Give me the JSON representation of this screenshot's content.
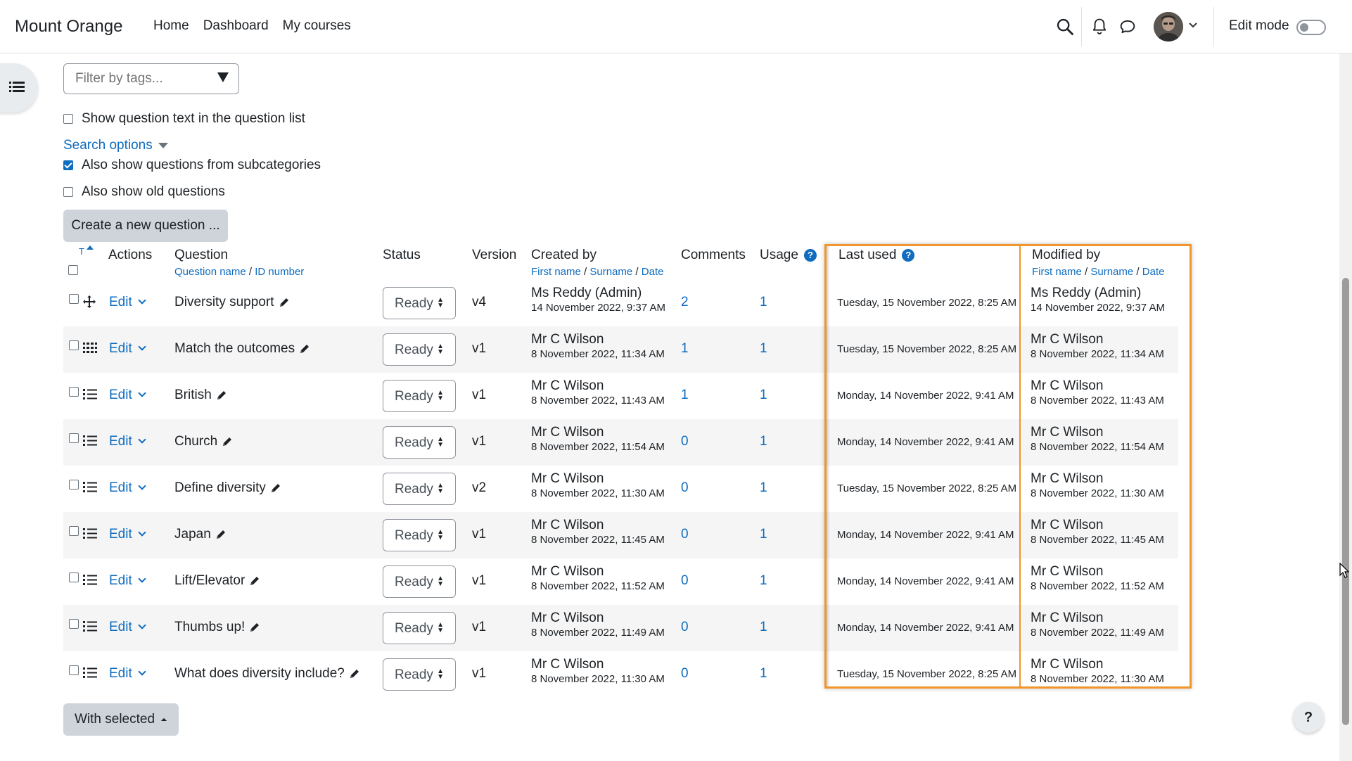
{
  "site": {
    "name": "Mount Orange"
  },
  "nav": {
    "home": "Home",
    "dashboard": "Dashboard",
    "my_courses": "My courses",
    "edit_mode": "Edit mode"
  },
  "filters": {
    "tags_placeholder": "Filter by tags...",
    "show_question_text": "Show question text in the question list",
    "search_options": "Search options",
    "subcategories": "Also show questions from subcategories",
    "old_questions": "Also show old questions",
    "create_button": "Create a new question ..."
  },
  "table": {
    "headers": {
      "type": "T",
      "actions": "Actions",
      "question": "Question",
      "question_name": "Question name",
      "id_number": "ID number",
      "status": "Status",
      "version": "Version",
      "created_by": "Created by",
      "first_name": "First name",
      "surname": "Surname",
      "date": "Date",
      "comments": "Comments",
      "usage": "Usage",
      "last_used": "Last used",
      "modified_by": "Modified by",
      "sep": "/"
    },
    "edit_label": "Edit",
    "rows": [
      {
        "icon": "move-icon",
        "question": "Diversity support",
        "status": "Ready",
        "version": "v4",
        "created_by": "Ms Reddy (Admin)",
        "created_date": "14 November 2022, 9:37 AM",
        "comments": "2",
        "usage": "1",
        "last_used": "Tuesday, 15 November 2022, 8:25 AM",
        "modified_by": "Ms Reddy (Admin)",
        "modified_date": "14 November 2022, 9:37 AM"
      },
      {
        "icon": "matching-icon",
        "question": "Match the outcomes",
        "status": "Ready",
        "version": "v1",
        "created_by": "Mr C Wilson",
        "created_date": "8 November 2022, 11:34 AM",
        "comments": "1",
        "usage": "1",
        "last_used": "Tuesday, 15 November 2022, 8:25 AM",
        "modified_by": "Mr C Wilson",
        "modified_date": "8 November 2022, 11:34 AM"
      },
      {
        "icon": "multichoice-icon",
        "question": "British",
        "status": "Ready",
        "version": "v1",
        "created_by": "Mr C Wilson",
        "created_date": "8 November 2022, 11:43 AM",
        "comments": "1",
        "usage": "1",
        "last_used": "Monday, 14 November 2022, 9:41 AM",
        "modified_by": "Mr C Wilson",
        "modified_date": "8 November 2022, 11:43 AM"
      },
      {
        "icon": "multichoice-icon",
        "question": "Church",
        "status": "Ready",
        "version": "v1",
        "created_by": "Mr C Wilson",
        "created_date": "8 November 2022, 11:54 AM",
        "comments": "0",
        "usage": "1",
        "last_used": "Monday, 14 November 2022, 9:41 AM",
        "modified_by": "Mr C Wilson",
        "modified_date": "8 November 2022, 11:54 AM"
      },
      {
        "icon": "multichoice-icon",
        "question": "Define diversity",
        "status": "Ready",
        "version": "v2",
        "created_by": "Mr C Wilson",
        "created_date": "8 November 2022, 11:30 AM",
        "comments": "0",
        "usage": "1",
        "last_used": "Tuesday, 15 November 2022, 8:25 AM",
        "modified_by": "Mr C Wilson",
        "modified_date": "8 November 2022, 11:30 AM"
      },
      {
        "icon": "multichoice-icon",
        "question": "Japan",
        "status": "Ready",
        "version": "v1",
        "created_by": "Mr C Wilson",
        "created_date": "8 November 2022, 11:45 AM",
        "comments": "0",
        "usage": "1",
        "last_used": "Monday, 14 November 2022, 9:41 AM",
        "modified_by": "Mr C Wilson",
        "modified_date": "8 November 2022, 11:45 AM"
      },
      {
        "icon": "multichoice-icon",
        "question": "Lift/Elevator",
        "status": "Ready",
        "version": "v1",
        "created_by": "Mr C Wilson",
        "created_date": "8 November 2022, 11:52 AM",
        "comments": "0",
        "usage": "1",
        "last_used": "Monday, 14 November 2022, 9:41 AM",
        "modified_by": "Mr C Wilson",
        "modified_date": "8 November 2022, 11:52 AM"
      },
      {
        "icon": "multichoice-icon",
        "question": "Thumbs up!",
        "status": "Ready",
        "version": "v1",
        "created_by": "Mr C Wilson",
        "created_date": "8 November 2022, 11:49 AM",
        "comments": "0",
        "usage": "1",
        "last_used": "Monday, 14 November 2022, 9:41 AM",
        "modified_by": "Mr C Wilson",
        "modified_date": "8 November 2022, 11:49 AM"
      },
      {
        "icon": "multichoice-icon",
        "question": "What does diversity include?",
        "status": "Ready",
        "version": "v1",
        "created_by": "Mr C Wilson",
        "created_date": "8 November 2022, 11:30 AM",
        "comments": "0",
        "usage": "1",
        "last_used": "Tuesday, 15 November 2022, 8:25 AM",
        "modified_by": "Mr C Wilson",
        "modified_date": "8 November 2022, 11:30 AM"
      }
    ]
  },
  "bulk": {
    "with_selected": "With selected"
  },
  "help": {
    "label": "?"
  },
  "colors": {
    "link": "#0f6cbf",
    "highlight": "#f0962a",
    "row_shade": "#f5f5f5",
    "button": "#ced4da"
  }
}
